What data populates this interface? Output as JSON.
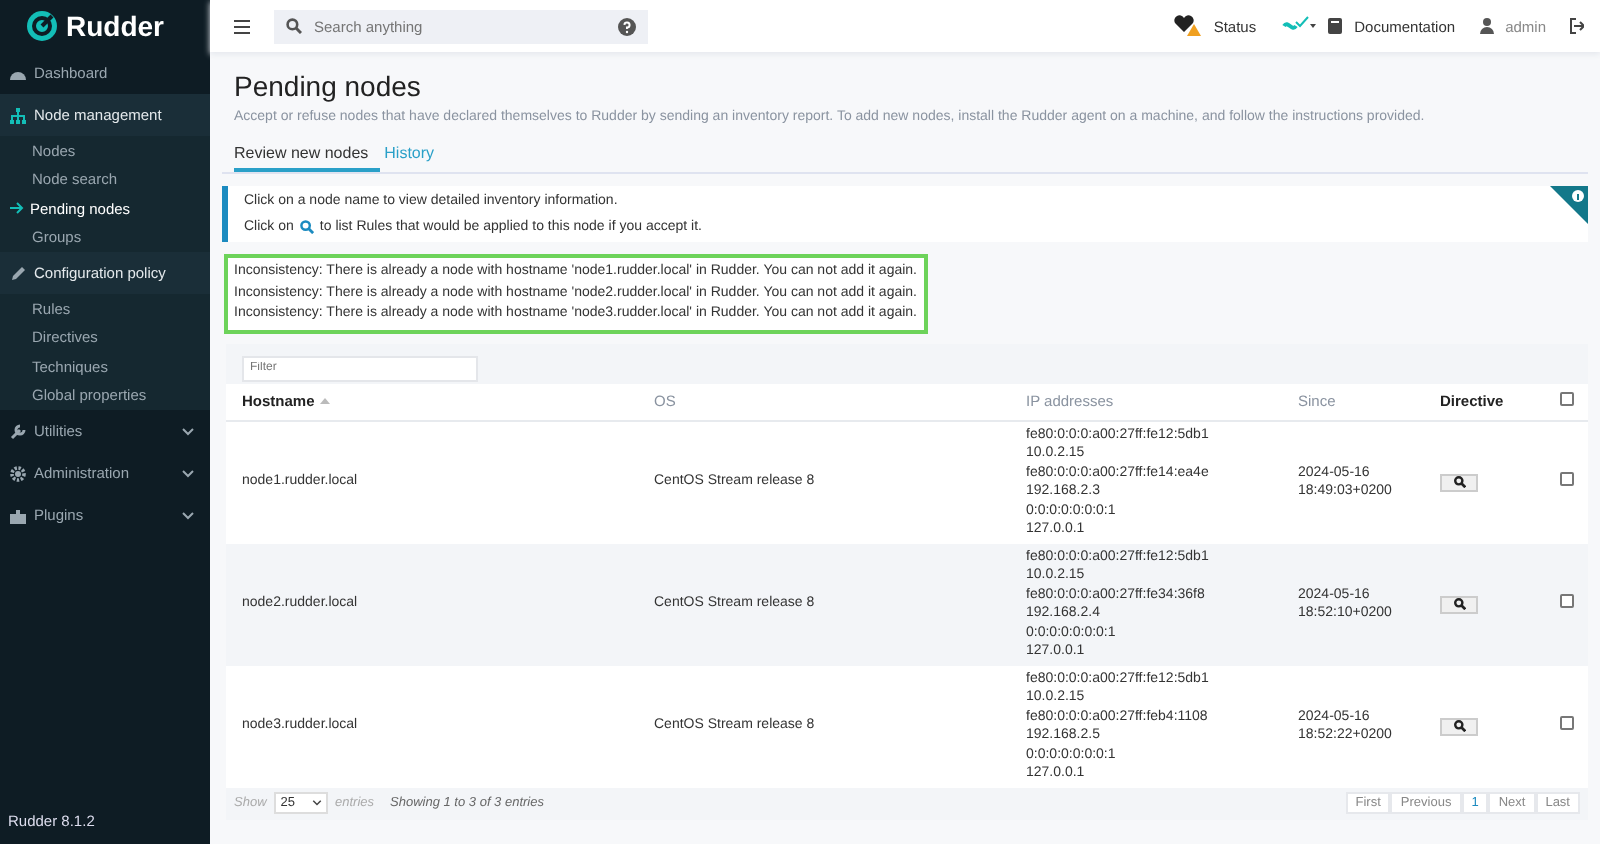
{
  "sidebar": {
    "brand": "Rudder",
    "items": [
      {
        "label": "Dashboard",
        "kind": "link"
      },
      {
        "label": "Node management",
        "kind": "menu",
        "expanded": true,
        "children": [
          {
            "label": "Nodes",
            "selected": false
          },
          {
            "label": "Node search",
            "selected": false
          },
          {
            "label": "Pending nodes",
            "selected": true
          },
          {
            "label": "Groups",
            "selected": false
          }
        ]
      },
      {
        "label": "Configuration policy",
        "kind": "menu",
        "expanded": true,
        "children": [
          {
            "label": "Rules",
            "selected": false
          },
          {
            "label": "Directives",
            "selected": false
          },
          {
            "label": "Techniques",
            "selected": false
          },
          {
            "label": "Global properties",
            "selected": false
          }
        ]
      },
      {
        "label": "Utilities",
        "kind": "menu",
        "expanded": false
      },
      {
        "label": "Administration",
        "kind": "menu",
        "expanded": false
      },
      {
        "label": "Plugins",
        "kind": "menu",
        "expanded": false
      }
    ],
    "version": "Rudder 8.1.2"
  },
  "topbar": {
    "search": {
      "placeholder": "Search anything"
    },
    "status": "Status",
    "documentation": "Documentation",
    "user": "admin"
  },
  "page": {
    "title": "Pending nodes",
    "description": "Accept or refuse nodes that have declared themselves to Rudder by sending an inventory report. To add new nodes, install the Rudder agent on a machine, and follow the instructions provided.",
    "tabs": [
      {
        "label": "Review new nodes",
        "selected": true
      },
      {
        "label": "History",
        "selected": false
      }
    ],
    "info": {
      "line1": "Click on a node name to view detailed inventory information.",
      "line2_before": "Click on",
      "line2_after": "to list Rules that would be applied to this node if you accept it."
    },
    "errors": [
      "Inconsistency: There is already a node with hostname 'node1.rudder.local' in Rudder. You can not add it again.",
      "Inconsistency: There is already a node with hostname 'node2.rudder.local' in Rudder. You can not add it again.",
      "Inconsistency: There is already a node with hostname 'node3.rudder.local' in Rudder. You can not add it again."
    ]
  },
  "table": {
    "filter": {
      "placeholder": "Filter"
    },
    "columns": [
      "Hostname",
      "OS",
      "IP addresses",
      "Since",
      "Directive"
    ],
    "select_all": {
      "checked": false
    },
    "rows": [
      {
        "hostname": "node1.rudder.local",
        "os": "CentOS Stream release 8",
        "ips": [
          "fe80:0:0:0:a00:27ff:fe12:5db1",
          "10.0.2.15",
          "fe80:0:0:0:a00:27ff:fe14:ea4e",
          "192.168.2.3",
          "0:0:0:0:0:0:0:1",
          "127.0.0.1"
        ],
        "since": [
          "2024-05-16",
          "18:49:03+0200"
        ],
        "checked": false
      },
      {
        "hostname": "node2.rudder.local",
        "os": "CentOS Stream release 8",
        "ips": [
          "fe80:0:0:0:a00:27ff:fe12:5db1",
          "10.0.2.15",
          "fe80:0:0:0:a00:27ff:fe34:36f8",
          "192.168.2.4",
          "0:0:0:0:0:0:0:1",
          "127.0.0.1"
        ],
        "since": [
          "2024-05-16",
          "18:52:10+0200"
        ],
        "checked": false
      },
      {
        "hostname": "node3.rudder.local",
        "os": "CentOS Stream release 8",
        "ips": [
          "fe80:0:0:0:a00:27ff:fe12:5db1",
          "10.0.2.15",
          "fe80:0:0:0:a00:27ff:feb4:1108",
          "192.168.2.5",
          "0:0:0:0:0:0:0:1",
          "127.0.0.1"
        ],
        "since": [
          "2024-05-16",
          "18:52:22+0200"
        ],
        "checked": false
      }
    ],
    "footer": {
      "show": "Show",
      "page_size": "25",
      "entries": "entries",
      "summary": "Showing 1 to 3 of 3 entries"
    },
    "pagination": [
      {
        "label": "First",
        "selected": false
      },
      {
        "label": "Previous",
        "selected": false
      },
      {
        "label": "1",
        "selected": true
      },
      {
        "label": "Next",
        "selected": false
      },
      {
        "label": "Last",
        "selected": false
      }
    ]
  }
}
